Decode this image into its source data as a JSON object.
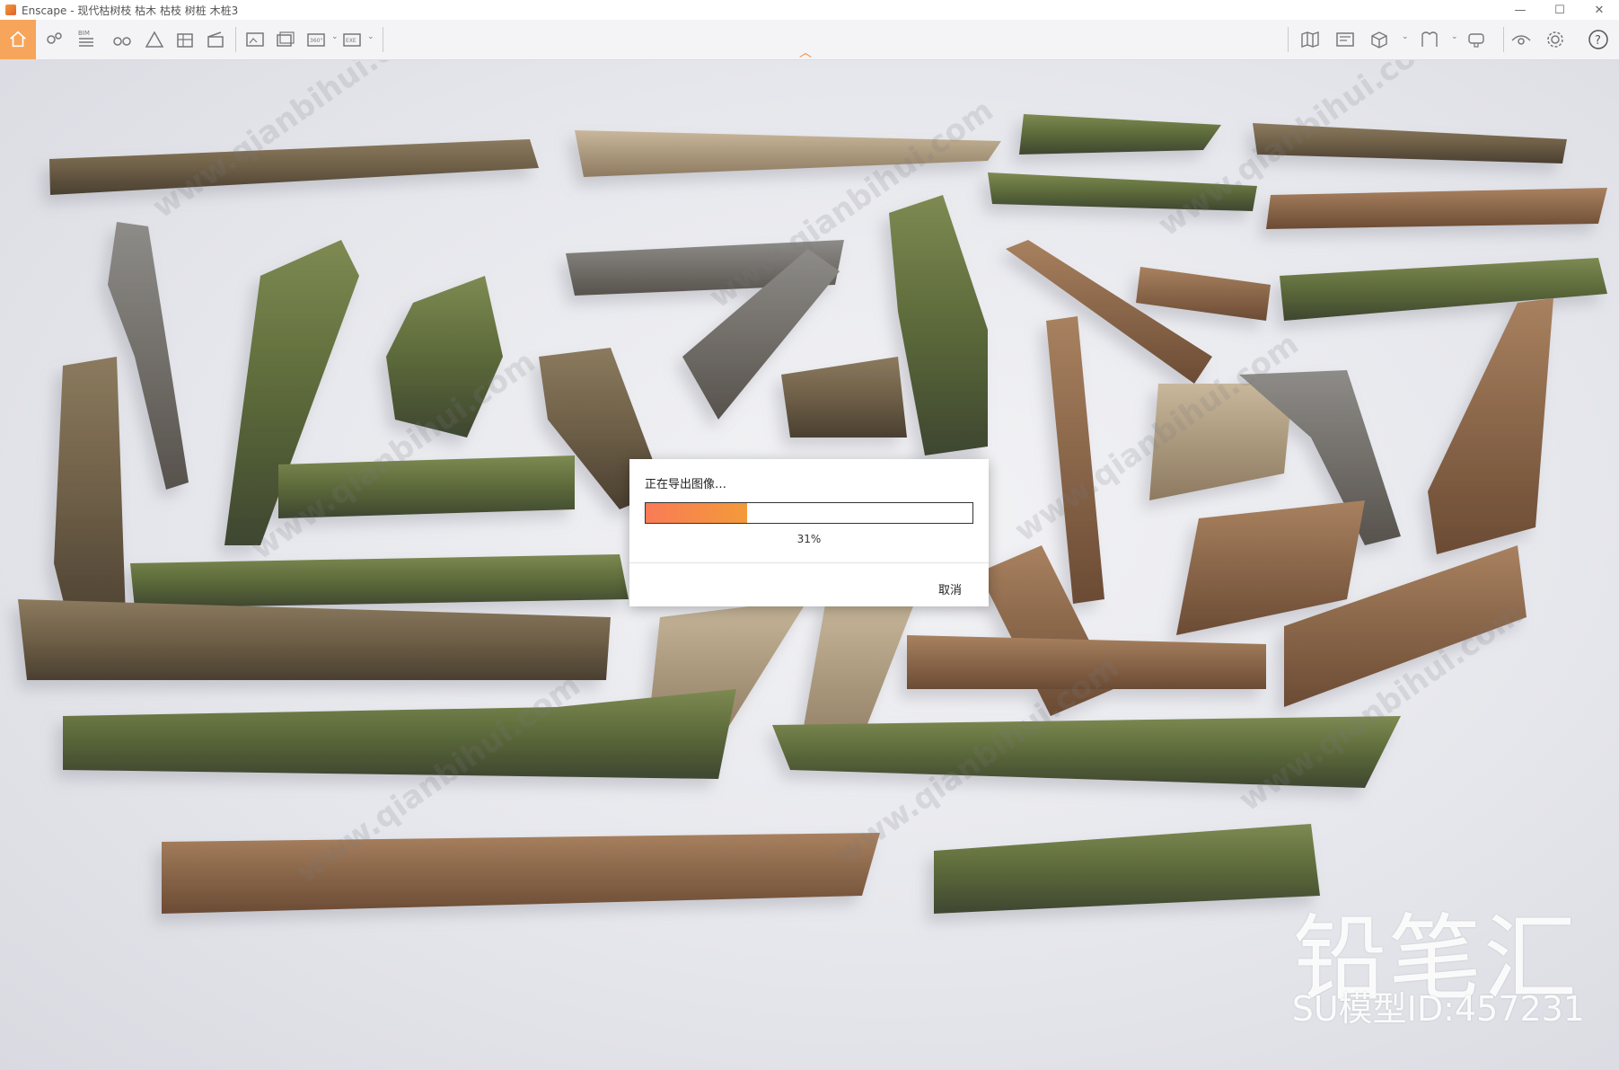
{
  "window": {
    "title": "Enscape - 现代枯树枝 枯木 枯枝 树桩 木桩3",
    "minimize": "—",
    "maximize": "☐",
    "close": "✕"
  },
  "toolbar": {
    "bim_label": "BIM",
    "view360_label": "360°",
    "exe_label": "EXE",
    "help_label": "?"
  },
  "dialog": {
    "title": "正在导出图像…",
    "progress_percent": 31,
    "progress_text": "31%",
    "cancel_label": "取消"
  },
  "watermark": {
    "brand": "铅笔汇",
    "model_id": "SU模型ID:457231",
    "site": "www.qianbihui.com"
  },
  "colors": {
    "accent": "#f39a3c",
    "progress_start": "#f97b56",
    "progress_end": "#f39a3a"
  }
}
